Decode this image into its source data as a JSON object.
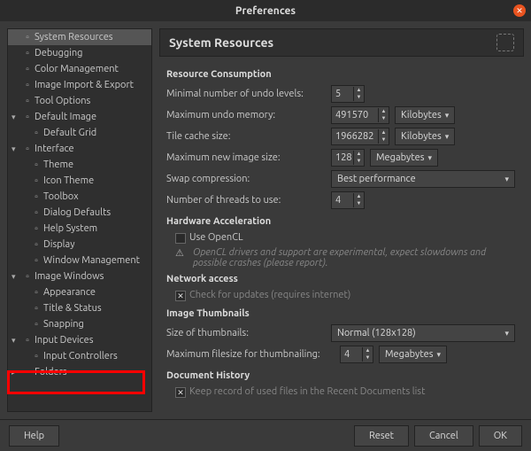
{
  "window": {
    "title": "Preferences"
  },
  "sidebar": {
    "items": [
      {
        "label": "System Resources",
        "depth": 0,
        "exp": "",
        "icon": "chip-icon",
        "sel": true
      },
      {
        "label": "Debugging",
        "depth": 0,
        "exp": "",
        "icon": "bug-icon"
      },
      {
        "label": "Color Management",
        "depth": 0,
        "exp": "",
        "icon": "color-icon"
      },
      {
        "label": "Image Import & Export",
        "depth": 0,
        "exp": "",
        "icon": "import-icon"
      },
      {
        "label": "Tool Options",
        "depth": 0,
        "exp": "",
        "icon": "tool-icon"
      },
      {
        "label": "Default Image",
        "depth": 0,
        "exp": "▾",
        "icon": "image-icon"
      },
      {
        "label": "Default Grid",
        "depth": 1,
        "exp": "",
        "icon": "grid-icon"
      },
      {
        "label": "Interface",
        "depth": 0,
        "exp": "▾",
        "icon": "interface-icon"
      },
      {
        "label": "Theme",
        "depth": 1,
        "exp": "",
        "icon": "theme-icon"
      },
      {
        "label": "Icon Theme",
        "depth": 1,
        "exp": "",
        "icon": "icontheme-icon"
      },
      {
        "label": "Toolbox",
        "depth": 1,
        "exp": "",
        "icon": "toolbox-icon"
      },
      {
        "label": "Dialog Defaults",
        "depth": 1,
        "exp": "",
        "icon": "dialog-icon"
      },
      {
        "label": "Help System",
        "depth": 1,
        "exp": "",
        "icon": "help-icon"
      },
      {
        "label": "Display",
        "depth": 1,
        "exp": "",
        "icon": "display-icon"
      },
      {
        "label": "Window Management",
        "depth": 1,
        "exp": "",
        "icon": "window-icon"
      },
      {
        "label": "Image Windows",
        "depth": 0,
        "exp": "▾",
        "icon": "imgwin-icon"
      },
      {
        "label": "Appearance",
        "depth": 1,
        "exp": "",
        "icon": "appear-icon"
      },
      {
        "label": "Title & Status",
        "depth": 1,
        "exp": "",
        "icon": "title-icon"
      },
      {
        "label": "Snapping",
        "depth": 1,
        "exp": "",
        "icon": "snap-icon"
      },
      {
        "label": "Input Devices",
        "depth": 0,
        "exp": "▾",
        "icon": "input-icon"
      },
      {
        "label": "Input Controllers",
        "depth": 1,
        "exp": "",
        "icon": "ctrl-icon"
      },
      {
        "label": "Folders",
        "depth": 0,
        "exp": "▸",
        "icon": "folder-icon"
      }
    ]
  },
  "header": {
    "title": "System Resources"
  },
  "sections": {
    "resource": {
      "title": "Resource Consumption",
      "undo_levels": {
        "label": "Minimal number of undo levels:",
        "value": "5"
      },
      "undo_mem": {
        "label": "Maximum undo memory:",
        "value": "491570",
        "unit": "Kilobytes"
      },
      "tile_cache": {
        "label": "Tile cache size:",
        "value": "1966282",
        "unit": "Kilobytes"
      },
      "new_img": {
        "label": "Maximum new image size:",
        "value": "128",
        "unit": "Megabytes"
      },
      "swap": {
        "label": "Swap compression:",
        "value": "Best performance"
      },
      "threads": {
        "label": "Number of threads to use:",
        "value": "4"
      }
    },
    "hw": {
      "title": "Hardware Acceleration",
      "opencl": {
        "label": "Use OpenCL"
      },
      "hint": "OpenCL drivers and support are experimental, expect slowdowns and possible crashes (please report)."
    },
    "net": {
      "title": "Network access",
      "updates": {
        "label": "Check for updates (requires internet)"
      }
    },
    "thumb": {
      "title": "Image Thumbnails",
      "size": {
        "label": "Size of thumbnails:",
        "value": "Normal (128x128)"
      },
      "maxfs": {
        "label": "Maximum filesize for thumbnailing:",
        "value": "4",
        "unit": "Megabytes"
      }
    },
    "doc": {
      "title": "Document History",
      "keep": {
        "label": "Keep record of used files in the Recent Documents list"
      }
    }
  },
  "footer": {
    "help": "Help",
    "reset": "Reset",
    "cancel": "Cancel",
    "ok": "OK"
  }
}
